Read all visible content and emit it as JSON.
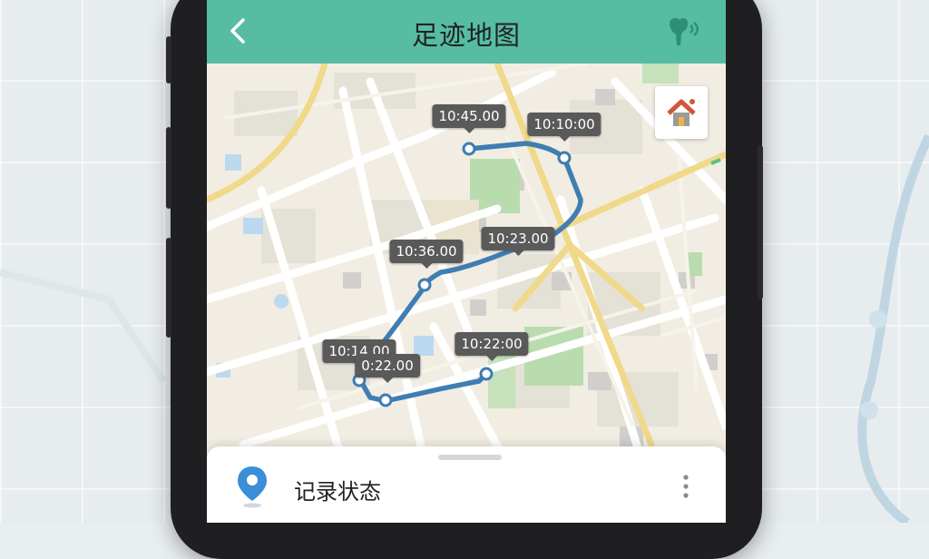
{
  "header": {
    "title": "足迹地图",
    "back_icon": "chevron-left-icon",
    "right_icon": "user-signal-icon"
  },
  "map": {
    "route_color": "#3f7db3",
    "time_labels": [
      "10:45.00",
      "10:10:00",
      "10:23.00",
      "10:36.00",
      "10:14.00",
      "0:22.00",
      "10:22:00"
    ]
  },
  "home_button": {
    "icon": "home-icon"
  },
  "sheet": {
    "title": "记录状态",
    "pin_icon": "location-pin-icon",
    "more_icon": "more-vertical-icon"
  },
  "colors": {
    "header": "#56bda3",
    "pin": "#3a8fd8"
  }
}
